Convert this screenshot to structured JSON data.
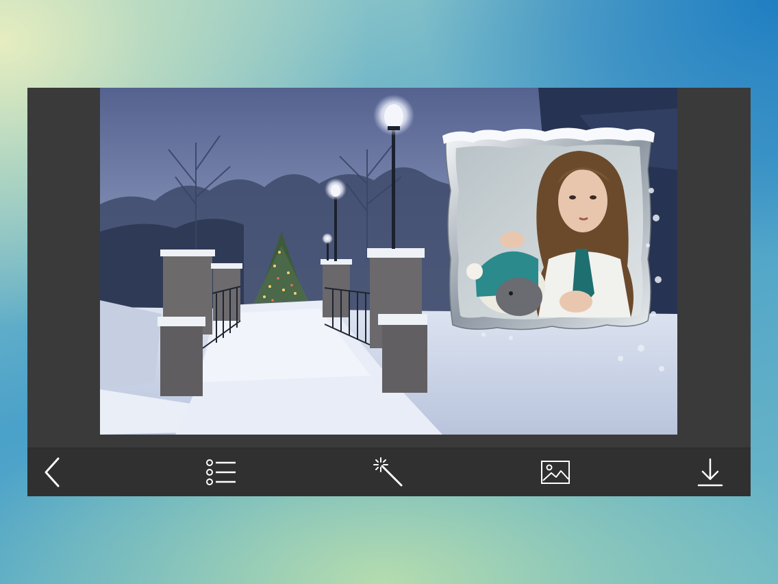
{
  "editor": {
    "background_scene": "snowy-park-bridge-at-dusk",
    "frame_style": "frosted-silver-snow-frame",
    "framed_photo": "girl-with-plush-hat"
  },
  "toolbar": {
    "buttons": [
      {
        "name": "back-button",
        "icon": "chevron-left-icon"
      },
      {
        "name": "frames-list-button",
        "icon": "list-icon"
      },
      {
        "name": "effects-button",
        "icon": "magic-wand-icon"
      },
      {
        "name": "gallery-button",
        "icon": "image-icon"
      },
      {
        "name": "save-button",
        "icon": "download-icon"
      }
    ],
    "icon_color": "#ffffff",
    "bar_color": "#303031"
  },
  "colors": {
    "panel": "#3a3a3b",
    "sky": "#6f7fa8",
    "snow": "#e9eef7"
  }
}
